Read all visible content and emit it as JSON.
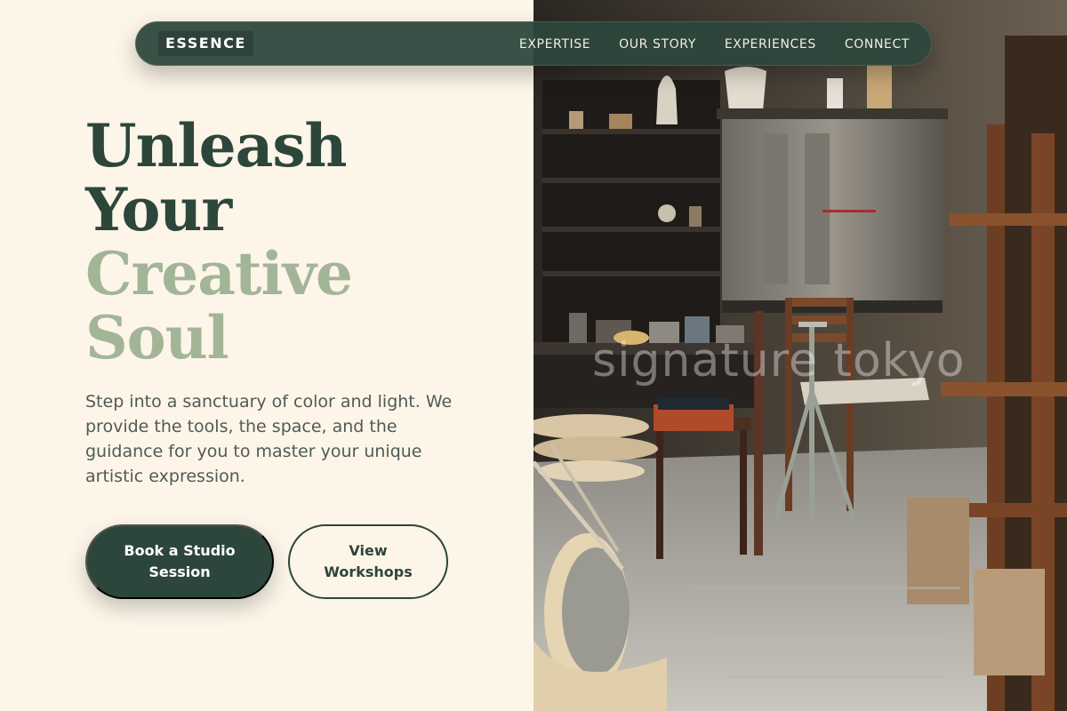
{
  "nav": {
    "brand": "ESSENCE",
    "links": [
      "EXPERTISE",
      "OUR STORY",
      "EXPERIENCES",
      "CONNECT"
    ]
  },
  "hero": {
    "title_lines": [
      "Unleash",
      "Your",
      "Creative",
      "Soul"
    ],
    "description": "Step into a sanctuary of color and light. We provide the tools, the space, and the guidance for you to master your unique artistic expression.",
    "primary_button": "Book a Studio Session",
    "secondary_button": "View Workshops"
  },
  "photo": {
    "watermark": "signature tokyo"
  },
  "colors": {
    "background": "#fdf5e8",
    "primary": "#2d463c",
    "accent_sage": "#a3b597",
    "body_text": "#505a55"
  }
}
